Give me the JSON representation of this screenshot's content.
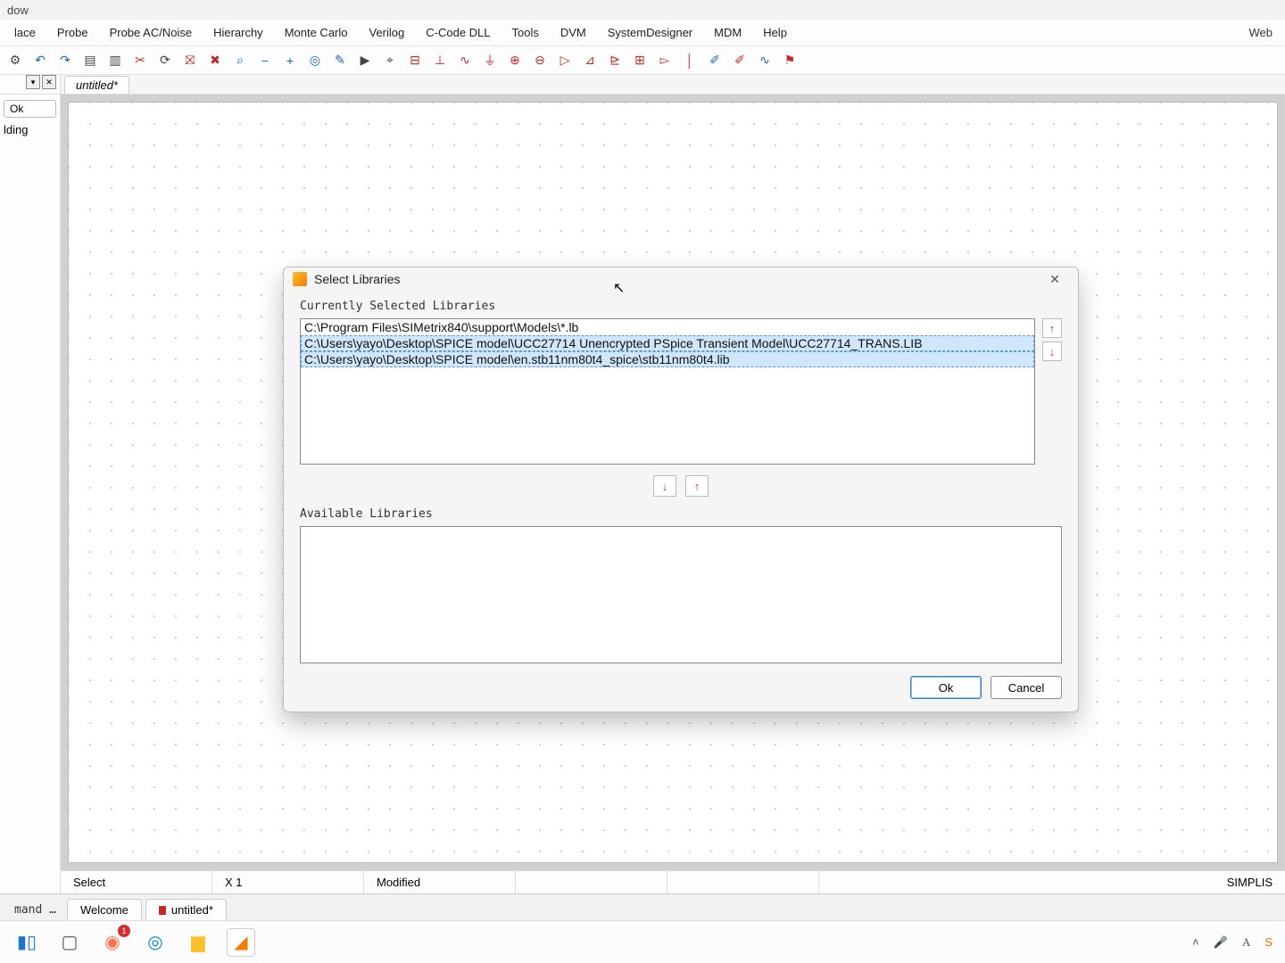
{
  "window_title_fragment": "dow",
  "menu": [
    "lace",
    "Probe",
    "Probe AC/Noise",
    "Hierarchy",
    "Monte Carlo",
    "Verilog",
    "C-Code DLL",
    "Tools",
    "DVM",
    "SystemDesigner",
    "MDM",
    "Help"
  ],
  "menu_right": "Web",
  "doc_tab": "untitled*",
  "left_panel": {
    "ok": "Ok",
    "lding": "lding"
  },
  "statusbar": {
    "mode": "Select",
    "zoom": "X 1",
    "state": "Modified",
    "sim": "SIMPLIS"
  },
  "bottom_left": "mand …",
  "bottom_tabs": [
    "Welcome",
    "untitled*"
  ],
  "dialog": {
    "title": "Select Libraries",
    "current_label": "Currently Selected Libraries",
    "available_label": "Available Libraries",
    "rows": [
      "C:\\Program Files\\SIMetrix840\\support\\Models\\*.lb",
      "C:\\Users\\yayo\\Desktop\\SPICE model\\UCC27714 Unencrypted PSpice Transient Model\\UCC27714_TRANS.LIB",
      "C:\\Users\\yayo\\Desktop\\SPICE model\\en.stb11nm80t4_spice\\stb11nm80t4.lib"
    ],
    "ok": "Ok",
    "cancel": "Cancel"
  },
  "taskbar": {
    "ff_badge": "1"
  },
  "toolbar_icons": [
    {
      "name": "gear-icon",
      "g": "⚙",
      "c": ""
    },
    {
      "name": "undo-icon",
      "g": "↶",
      "c": "blue"
    },
    {
      "name": "redo-icon",
      "g": "↷",
      "c": "blue"
    },
    {
      "name": "new-doc-icon",
      "g": "▤",
      "c": ""
    },
    {
      "name": "folder-icon",
      "g": "▥",
      "c": ""
    },
    {
      "name": "cut-icon",
      "g": "✂",
      "c": "red"
    },
    {
      "name": "refresh-icon",
      "g": "⟳",
      "c": ""
    },
    {
      "name": "delete-all-icon",
      "g": "⛝",
      "c": "red"
    },
    {
      "name": "delete-icon",
      "g": "✖",
      "c": "red"
    },
    {
      "name": "zoom-fit-icon",
      "g": "⌕",
      "c": "blue"
    },
    {
      "name": "zoom-out-icon",
      "g": "−",
      "c": "blue"
    },
    {
      "name": "zoom-in-icon",
      "g": "+",
      "c": "blue"
    },
    {
      "name": "zoom-sel-icon",
      "g": "◎",
      "c": "blue"
    },
    {
      "name": "pencil-icon",
      "g": "✎",
      "c": "blue"
    },
    {
      "name": "run-icon",
      "g": "▶",
      "c": ""
    },
    {
      "name": "search-icon",
      "g": "⌖",
      "c": ""
    },
    {
      "name": "resistor-icon",
      "g": "⊟",
      "c": "red"
    },
    {
      "name": "capacitor-icon",
      "g": "⊥",
      "c": "red"
    },
    {
      "name": "inductor-icon",
      "g": "∿",
      "c": "red"
    },
    {
      "name": "ground-icon",
      "g": "⏚",
      "c": "red"
    },
    {
      "name": "vsource-icon",
      "g": "⊕",
      "c": "red"
    },
    {
      "name": "isource-icon",
      "g": "⊖",
      "c": "red"
    },
    {
      "name": "diode-icon",
      "g": "▷",
      "c": "red"
    },
    {
      "name": "npn-icon",
      "g": "⊿",
      "c": "red"
    },
    {
      "name": "pnp-icon",
      "g": "⊵",
      "c": "red"
    },
    {
      "name": "mosfet-icon",
      "g": "⊞",
      "c": "red"
    },
    {
      "name": "opamp-icon",
      "g": "▻",
      "c": "red"
    },
    {
      "name": "wire-icon",
      "g": "│",
      "c": "red"
    },
    {
      "name": "probe-v-icon",
      "g": "✐",
      "c": "blue"
    },
    {
      "name": "probe-i-icon",
      "g": "✐",
      "c": "red"
    },
    {
      "name": "wave-icon",
      "g": "∿",
      "c": "blue"
    },
    {
      "name": "marker-icon",
      "g": "⚑",
      "c": "red"
    }
  ]
}
